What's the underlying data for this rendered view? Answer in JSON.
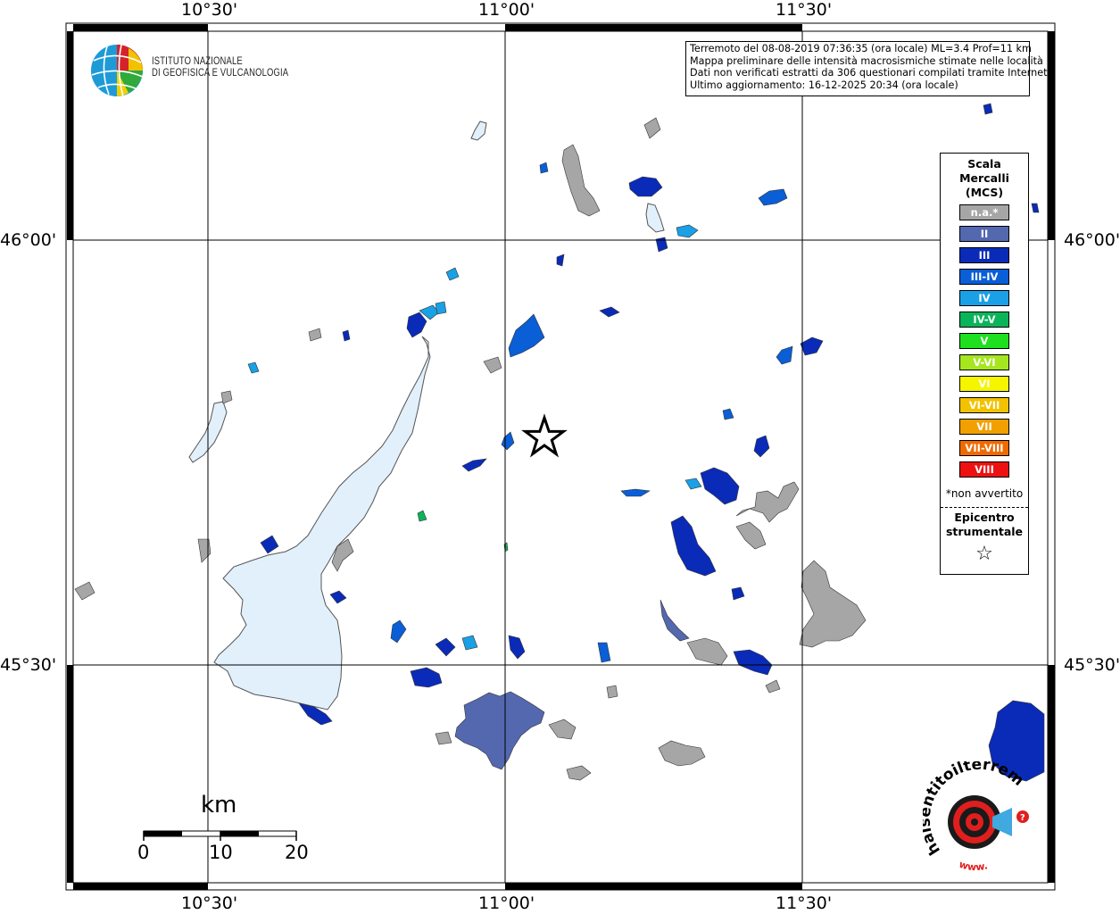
{
  "map": {
    "latitude_labels": [
      "46°00'",
      "45°30'"
    ],
    "longitude_labels": [
      "10°30'",
      "11°00'",
      "11°30'"
    ],
    "colors": {
      "frame": "#000000",
      "lake_fill": "#e1f0fb",
      "na_gray": "#a6a6a6",
      "ii": "#5468b0",
      "iii": "#0a2bb8",
      "iii_iv": "#0a5ed6",
      "iv": "#1aa0e6",
      "iv_v": "#0ab55a"
    },
    "epicenter_symbol": "star"
  },
  "info_box": {
    "lines": [
      "Terremoto del 08-08-2019 07:36:35 (ora locale) ML=3.4 Prof=11 km",
      "Mappa preliminare delle intensità macrosismiche stimate nelle località",
      "Dati non verificati estratti da 306 questionari compilati tramite Internet.",
      "Ultimo aggiornamento: 16-12-2025 20:34 (ora locale)"
    ]
  },
  "legend": {
    "title_lines": [
      "Scala",
      "Mercalli",
      "(MCS)"
    ],
    "levels": [
      {
        "label": "n.a.*",
        "color": "#a6a6a6"
      },
      {
        "label": "II",
        "color": "#5468b0"
      },
      {
        "label": "III",
        "color": "#0a2bb8"
      },
      {
        "label": "III-IV",
        "color": "#0a5ed6"
      },
      {
        "label": "IV",
        "color": "#1aa0e6"
      },
      {
        "label": "IV-V",
        "color": "#0ab55a"
      },
      {
        "label": "V",
        "color": "#1fe01f"
      },
      {
        "label": "V-VI",
        "color": "#a6e61f"
      },
      {
        "label": "VI",
        "color": "#f5f500"
      },
      {
        "label": "VI-VII",
        "color": "#f2c200"
      },
      {
        "label": "VII",
        "color": "#f2a000"
      },
      {
        "label": "VII-VIII",
        "color": "#f06a00"
      },
      {
        "label": "VIII",
        "color": "#ee1111"
      }
    ],
    "note": "*non avvertito",
    "epicenter_lines": [
      "Epicentro",
      "strumentale"
    ],
    "epicenter_symbol": "☆"
  },
  "ingv_logo": {
    "lines": [
      "ISTITUTO NAZIONALE",
      "DI GEOFISICA E VULCANOLOGIA"
    ]
  },
  "scale_bar": {
    "unit": "km",
    "labels": [
      "0",
      "10",
      "20"
    ]
  },
  "hsit_logo": {
    "text": "haisentitoilterremoto.it",
    "url_text": "www."
  }
}
